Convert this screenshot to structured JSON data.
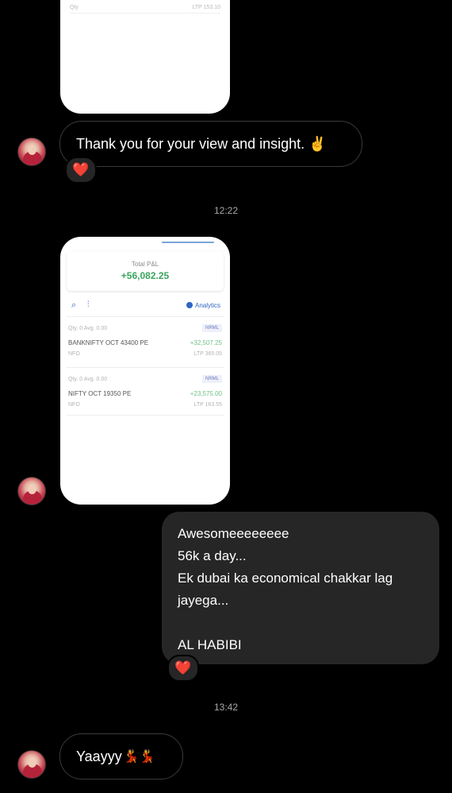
{
  "top_card": {
    "left_text": "Qty",
    "right_text": "LTP 153.10"
  },
  "messages": {
    "thanks": {
      "text": "Thank you for your view and insight. ✌️",
      "reaction": "❤️"
    },
    "timestamp_1": "12:22",
    "screenshot": {
      "total_pnl_label": "Total P&L",
      "total_pnl_value": "+56,082.25",
      "search_icon": "🔍",
      "filter_icon": "⫶",
      "analytics_label": "Analytics",
      "positions": [
        {
          "qty_text": "Qty. 0   Avg. 0.00",
          "product": "NRML",
          "instrument": "BANKNIFTY OCT 43400 PE",
          "pnl": "+32,507.25",
          "segment": "NFO",
          "ltp": "LTP 365.05"
        },
        {
          "qty_text": "Qty. 0   Avg. 0.00",
          "product": "NRML",
          "instrument": "NIFTY OCT 19350 PE",
          "pnl": "+23,575.00",
          "segment": "NFO",
          "ltp": "LTP 163.55"
        }
      ]
    },
    "sent": {
      "lines": [
        "Awesomeeeeeeee",
        "56k a day...",
        "Ek dubai ka economical chakkar lag",
        "jayega...",
        "",
        "AL HABIBI"
      ],
      "reaction": "❤️"
    },
    "timestamp_2": "13:42",
    "yay": {
      "text": "Yaayyy",
      "emoji": "💃💃"
    }
  },
  "colors": {
    "background": "#000000",
    "sent_bubble": "#262626",
    "received_border": "#3a3a3a",
    "pnl_green": "#3aa45f",
    "accent_blue": "#2f66c4"
  }
}
